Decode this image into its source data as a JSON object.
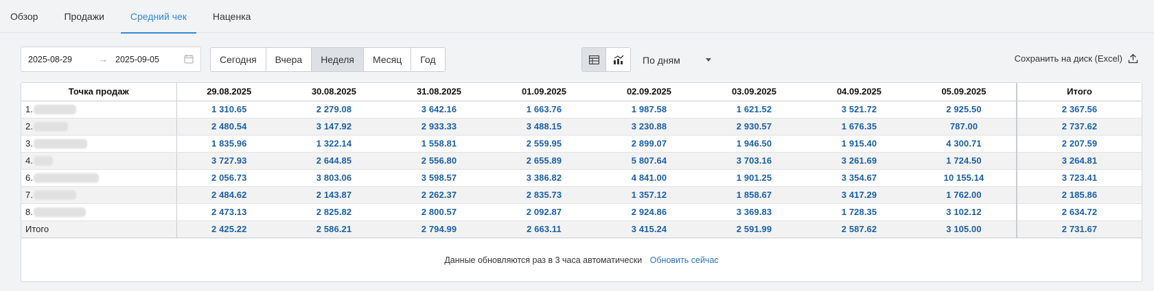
{
  "tabs": [
    {
      "label": "Обзор",
      "active": false
    },
    {
      "label": "Продажи",
      "active": false
    },
    {
      "label": "Средний чек",
      "active": true
    },
    {
      "label": "Наценка",
      "active": false
    }
  ],
  "date_range": {
    "from": "2025-08-29",
    "arrow": "→",
    "to": "2025-09-05"
  },
  "periods": [
    {
      "label": "Сегодня",
      "active": false
    },
    {
      "label": "Вчера",
      "active": false
    },
    {
      "label": "Неделя",
      "active": true
    },
    {
      "label": "Месяц",
      "active": false
    },
    {
      "label": "Год",
      "active": false
    }
  ],
  "view_toggle": {
    "active": "table"
  },
  "group_by": {
    "value": "По дням"
  },
  "export_label": "Сохранить на диск (Excel)",
  "table": {
    "name_header": "Точка продаж",
    "date_headers": [
      "29.08.2025",
      "30.08.2025",
      "31.08.2025",
      "01.09.2025",
      "02.09.2025",
      "03.09.2025",
      "04.09.2025",
      "05.09.2025"
    ],
    "total_header": "Итого",
    "rows": [
      {
        "prefix": "1.",
        "values": [
          "1 310.65",
          "2 279.08",
          "3 642.16",
          "1 663.76",
          "1 987.58",
          "1 621.52",
          "3 521.72",
          "2 925.50"
        ],
        "total": "2 367.56"
      },
      {
        "prefix": "2.",
        "values": [
          "2 480.54",
          "3 147.92",
          "2 933.33",
          "3 488.15",
          "3 230.88",
          "2 930.57",
          "1 676.35",
          "787.00"
        ],
        "total": "2 737.62"
      },
      {
        "prefix": "3.",
        "values": [
          "1 835.96",
          "1 322.14",
          "1 558.81",
          "2 559.95",
          "2 899.07",
          "1 946.50",
          "1 915.40",
          "4 300.71"
        ],
        "total": "2 207.59"
      },
      {
        "prefix": "4.",
        "values": [
          "3 727.93",
          "2 644.85",
          "2 556.80",
          "2 655.89",
          "5 807.64",
          "3 703.16",
          "3 261.69",
          "1 724.50"
        ],
        "total": "3 264.81"
      },
      {
        "prefix": "6.",
        "values": [
          "2 056.73",
          "3 803.06",
          "3 598.57",
          "3 386.82",
          "4 841.00",
          "1 901.25",
          "3 354.67",
          "10 155.14"
        ],
        "total": "3 723.41"
      },
      {
        "prefix": "7.",
        "values": [
          "2 484.62",
          "2 143.87",
          "2 262.37",
          "2 835.73",
          "1 357.12",
          "1 858.67",
          "3 417.29",
          "1 762.00"
        ],
        "total": "2 185.86"
      },
      {
        "prefix": "8.",
        "values": [
          "2 473.13",
          "2 825.82",
          "2 800.57",
          "2 092.87",
          "2 924.86",
          "3 369.83",
          "1 728.35",
          "3 102.12"
        ],
        "total": "2 634.72"
      }
    ],
    "summary": {
      "label": "Итого",
      "values": [
        "2 425.22",
        "2 586.21",
        "2 794.99",
        "2 663.11",
        "3 415.24",
        "2 591.99",
        "2 587.62",
        "3 105.00"
      ],
      "total": "2 731.67"
    }
  },
  "footnote": {
    "text": "Данные обновляются раз в 3 часа автоматически",
    "link": "Обновить сейчас"
  },
  "colors": {
    "accent": "#2e8ad8",
    "value": "#1a5fa8",
    "row_alt": "#f2f2f2"
  }
}
